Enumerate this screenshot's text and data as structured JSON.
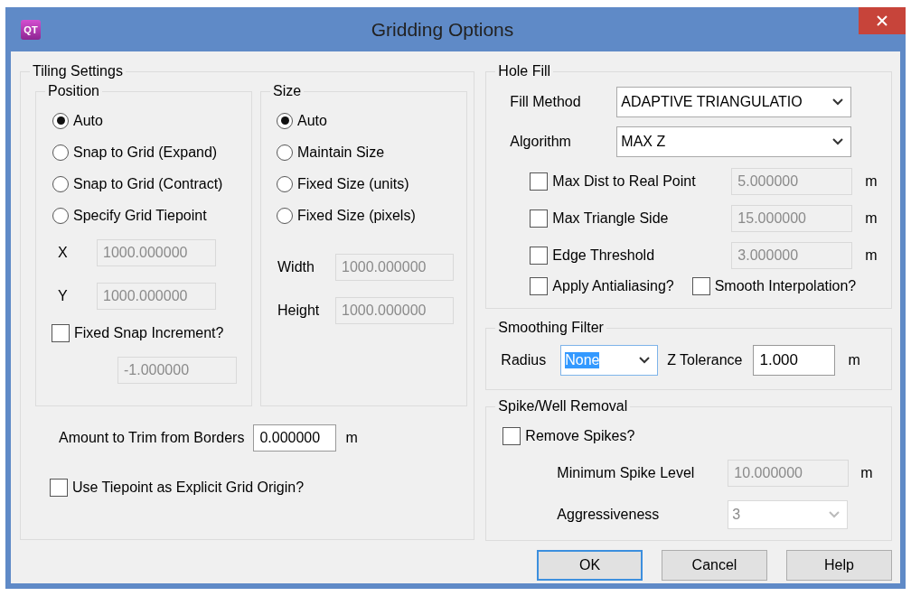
{
  "window": {
    "title": "Gridding Options",
    "icon_text": "QT"
  },
  "tiling": {
    "title": "Tiling Settings",
    "position": {
      "title": "Position",
      "options": [
        {
          "label": "Auto",
          "selected": true
        },
        {
          "label": "Snap to Grid (Expand)",
          "selected": false
        },
        {
          "label": "Snap to Grid (Contract)",
          "selected": false
        },
        {
          "label": "Specify Grid Tiepoint",
          "selected": false
        }
      ],
      "x": {
        "label": "X",
        "value": "1000.000000",
        "disabled": true
      },
      "y": {
        "label": "Y",
        "value": "1000.000000",
        "disabled": true
      },
      "fixed_snap": {
        "label": "Fixed Snap Increment?",
        "checked": false
      },
      "snap_increment": {
        "value": "-1.000000",
        "disabled": true
      }
    },
    "size": {
      "title": "Size",
      "options": [
        {
          "label": "Auto",
          "selected": true
        },
        {
          "label": "Maintain Size",
          "selected": false
        },
        {
          "label": "Fixed Size (units)",
          "selected": false
        },
        {
          "label": "Fixed Size (pixels)",
          "selected": false
        }
      ],
      "width": {
        "label": "Width",
        "value": "1000.000000",
        "disabled": true
      },
      "height": {
        "label": "Height",
        "value": "1000.000000",
        "disabled": true
      }
    },
    "trim": {
      "label": "Amount to Trim from Borders",
      "value": "0.000000",
      "disabled": false,
      "unit": "m"
    },
    "use_tiepoint": {
      "label": "Use Tiepoint as Explicit Grid Origin?",
      "checked": false
    }
  },
  "hole_fill": {
    "title": "Hole Fill",
    "fill_method": {
      "label": "Fill Method",
      "value": "ADAPTIVE TRIANGULATIO"
    },
    "algorithm": {
      "label": "Algorithm",
      "value": "MAX Z"
    },
    "limits": [
      {
        "label": "Max Dist to Real Point",
        "checked": false,
        "value": "5.000000",
        "disabled": true,
        "unit": "m"
      },
      {
        "label": "Max Triangle Side",
        "checked": false,
        "value": "15.000000",
        "disabled": true,
        "unit": "m"
      },
      {
        "label": "Edge Threshold",
        "checked": false,
        "value": "3.000000",
        "disabled": true,
        "unit": "m"
      }
    ],
    "antialiasing": {
      "label": "Apply Antialiasing?",
      "checked": false
    },
    "smooth_interpolation": {
      "label": "Smooth Interpolation?",
      "checked": false
    }
  },
  "smoothing": {
    "title": "Smoothing Filter",
    "radius": {
      "label": "Radius",
      "value": "None",
      "text_selected": true
    },
    "z_tolerance": {
      "label": "Z Tolerance",
      "value": "1.000",
      "disabled": false,
      "unit": "m"
    }
  },
  "spike": {
    "title": "Spike/Well Removal",
    "remove": {
      "label": "Remove Spikes?",
      "checked": false
    },
    "min_level": {
      "label": "Minimum Spike Level",
      "value": "10.000000",
      "disabled": true,
      "unit": "m"
    },
    "aggressiveness": {
      "label": "Aggressiveness",
      "value": "3",
      "disabled": true
    }
  },
  "buttons": [
    {
      "label": "OK",
      "default": true
    },
    {
      "label": "Cancel",
      "default": false
    },
    {
      "label": "Help",
      "default": false
    }
  ]
}
